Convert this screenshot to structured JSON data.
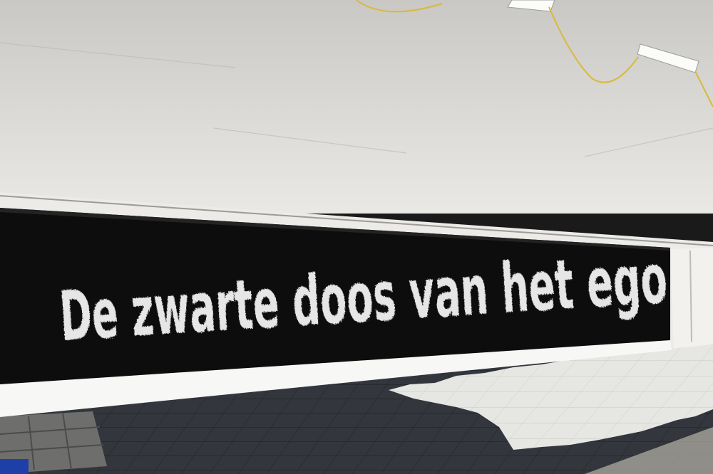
{
  "banner": {
    "text": "De zwarte doos van het ego"
  },
  "colors": {
    "ceiling": "#d9d8d4",
    "wall": "#e8e7e3",
    "banner": "#0d0d0d",
    "paint": "#e6e6e6",
    "floor_dark": "#2f3338",
    "floor_light": "#e4e4e2",
    "cable": "#d9b93a"
  }
}
